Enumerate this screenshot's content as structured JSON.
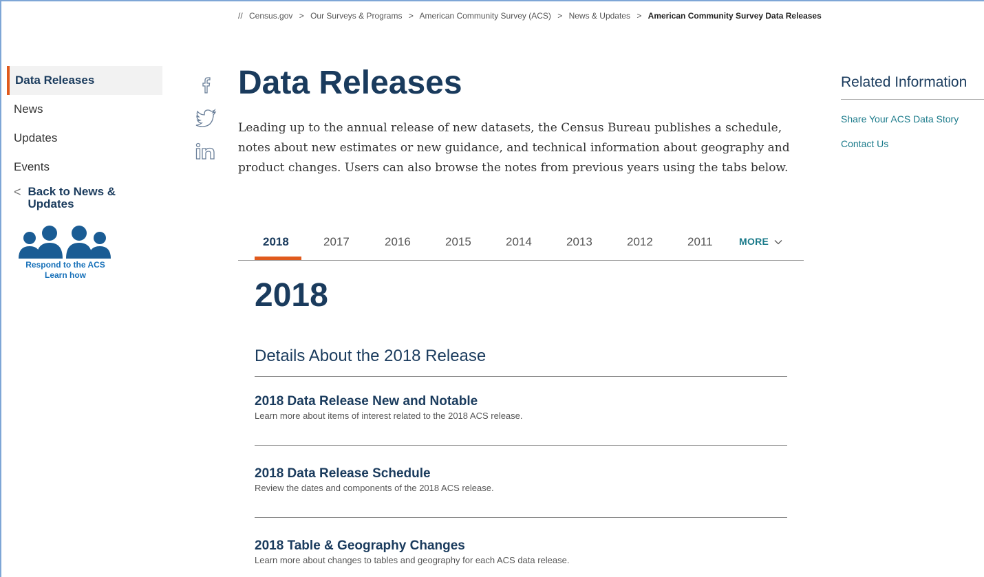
{
  "breadcrumb": {
    "prefix": "//",
    "items": [
      "Census.gov",
      "Our Surveys & Programs",
      "American Community Survey (ACS)",
      "News & Updates"
    ],
    "current": "American Community Survey Data Releases",
    "separator": ">"
  },
  "leftnav": {
    "items": [
      {
        "label": "Data Releases",
        "active": true
      },
      {
        "label": "News"
      },
      {
        "label": "Updates"
      },
      {
        "label": "Events"
      }
    ],
    "back_label": "Back to News & Updates",
    "respond_line1": "Respond to the ACS",
    "respond_line2": "Learn how"
  },
  "social": [
    "facebook-icon",
    "twitter-icon",
    "linkedin-icon"
  ],
  "main": {
    "title": "Data Releases",
    "intro": "Leading up to the annual release of new datasets, the Census Bureau publishes a schedule, notes about new estimates or new guidance, and technical information about geography and product changes. Users can also browse the notes from previous years using the tabs below."
  },
  "tabs": {
    "items": [
      "2018",
      "2017",
      "2016",
      "2015",
      "2014",
      "2013",
      "2012",
      "2011"
    ],
    "selected": "2018",
    "more_label": "MORE"
  },
  "section": {
    "year_title": "2018",
    "details_heading": "Details About the 2018 Release",
    "entries": [
      {
        "title": "2018 Data Release New and Notable",
        "desc": "Learn more about items of interest related to the 2018 ACS release."
      },
      {
        "title": "2018 Data Release Schedule",
        "desc": "Review the dates and components of the 2018 ACS release."
      },
      {
        "title": "2018 Table & Geography Changes",
        "desc": "Learn more about changes to tables and geography for each ACS data release."
      }
    ]
  },
  "related": {
    "heading": "Related Information",
    "links": [
      "Share Your ACS Data Story",
      "Contact Us"
    ]
  },
  "colors": {
    "accent": "#e05a1d",
    "navy": "#1a3b5d",
    "link": "#1a7a8a",
    "respond_blue": "#1670b9"
  }
}
